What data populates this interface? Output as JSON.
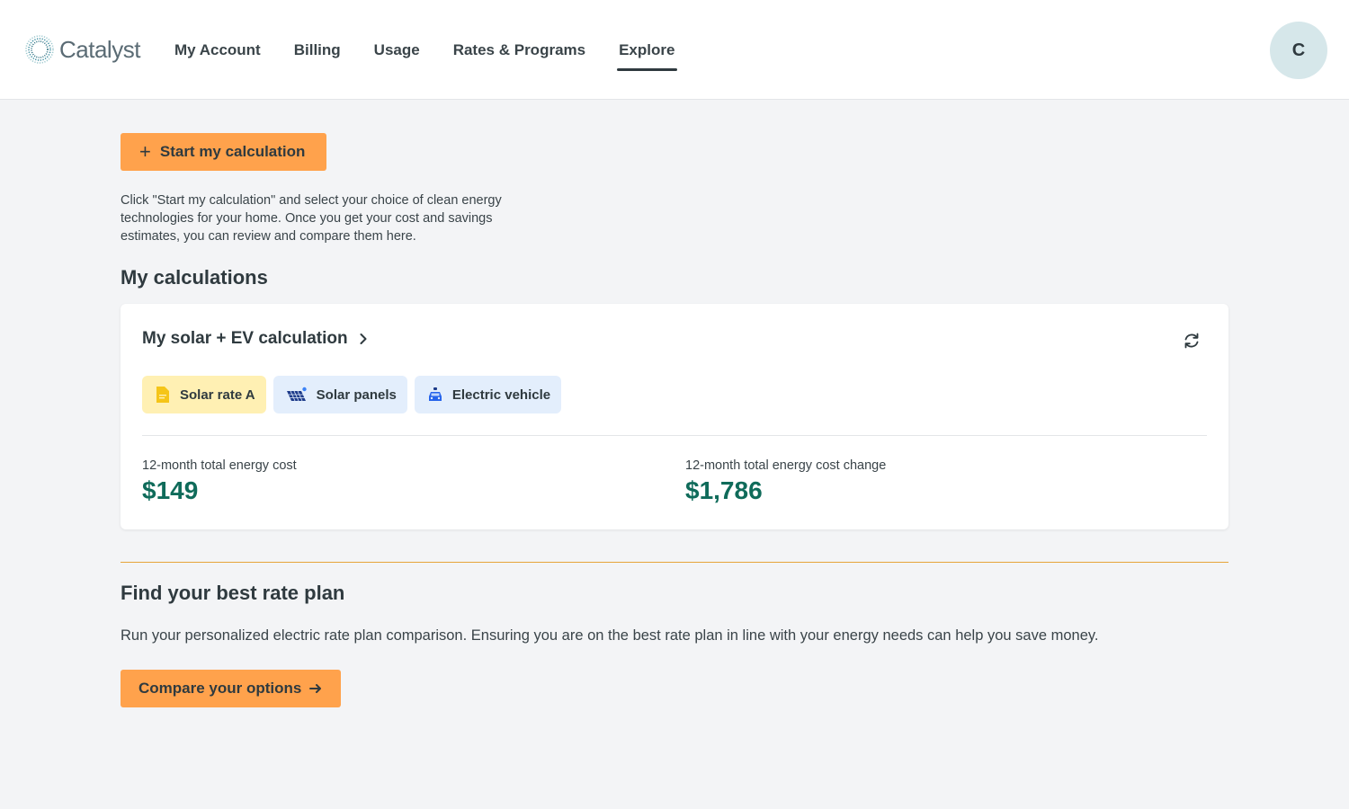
{
  "header": {
    "brand": "Catalyst",
    "nav": [
      {
        "label": "My Account"
      },
      {
        "label": "Billing"
      },
      {
        "label": "Usage"
      },
      {
        "label": "Rates & Programs"
      },
      {
        "label": "Explore"
      }
    ],
    "active_nav": "Explore",
    "avatar_initial": "C"
  },
  "main": {
    "start_button": {
      "icon": "plus-icon",
      "label": "Start my calculation"
    },
    "intro_text": "Click \"Start my calculation\" and select your choice of clean energy technologies for your home. Once you get your cost and savings estimates, you can review and compare them here.",
    "calculations_title": "My calculations",
    "calculation_card": {
      "title": "My solar + EV calculation",
      "chips": [
        {
          "label": "Solar rate A",
          "icon": "document-icon",
          "color": "#fff0b3"
        },
        {
          "label": "Solar panels",
          "icon": "solar-panel-icon",
          "color": "#e3eefc"
        },
        {
          "label": "Electric vehicle",
          "icon": "car-icon",
          "color": "#e3eefc"
        }
      ],
      "stats": [
        {
          "label": "12-month total energy cost",
          "value": "$149"
        },
        {
          "label": "12-month total energy cost change",
          "value": "$1,786"
        }
      ]
    },
    "rate_plan": {
      "title": "Find your best rate plan",
      "description": "Run your personalized electric rate plan comparison. Ensuring you are on the best rate plan in line with your energy needs can help you save money.",
      "button_label": "Compare your options"
    }
  },
  "colors": {
    "accent": "#ffa24c",
    "money": "#0f6b5a",
    "divider_gold": "#e6a53a"
  }
}
